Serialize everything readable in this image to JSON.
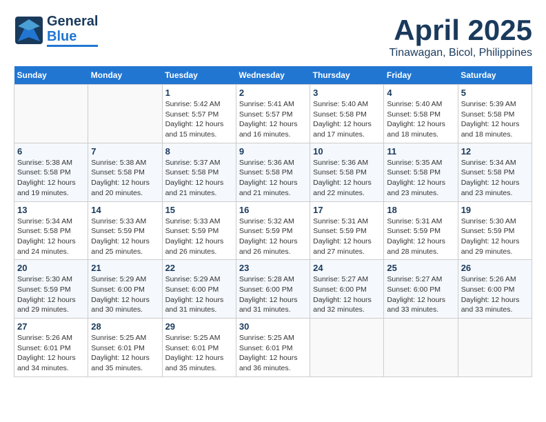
{
  "header": {
    "logo_general": "General",
    "logo_blue": "Blue",
    "month_title": "April 2025",
    "location": "Tinawagan, Bicol, Philippines"
  },
  "weekdays": [
    "Sunday",
    "Monday",
    "Tuesday",
    "Wednesday",
    "Thursday",
    "Friday",
    "Saturday"
  ],
  "weeks": [
    [
      {
        "day": "",
        "sunrise": "",
        "sunset": "",
        "daylight": ""
      },
      {
        "day": "",
        "sunrise": "",
        "sunset": "",
        "daylight": ""
      },
      {
        "day": "1",
        "sunrise": "Sunrise: 5:42 AM",
        "sunset": "Sunset: 5:57 PM",
        "daylight": "Daylight: 12 hours and 15 minutes."
      },
      {
        "day": "2",
        "sunrise": "Sunrise: 5:41 AM",
        "sunset": "Sunset: 5:57 PM",
        "daylight": "Daylight: 12 hours and 16 minutes."
      },
      {
        "day": "3",
        "sunrise": "Sunrise: 5:40 AM",
        "sunset": "Sunset: 5:58 PM",
        "daylight": "Daylight: 12 hours and 17 minutes."
      },
      {
        "day": "4",
        "sunrise": "Sunrise: 5:40 AM",
        "sunset": "Sunset: 5:58 PM",
        "daylight": "Daylight: 12 hours and 18 minutes."
      },
      {
        "day": "5",
        "sunrise": "Sunrise: 5:39 AM",
        "sunset": "Sunset: 5:58 PM",
        "daylight": "Daylight: 12 hours and 18 minutes."
      }
    ],
    [
      {
        "day": "6",
        "sunrise": "Sunrise: 5:38 AM",
        "sunset": "Sunset: 5:58 PM",
        "daylight": "Daylight: 12 hours and 19 minutes."
      },
      {
        "day": "7",
        "sunrise": "Sunrise: 5:38 AM",
        "sunset": "Sunset: 5:58 PM",
        "daylight": "Daylight: 12 hours and 20 minutes."
      },
      {
        "day": "8",
        "sunrise": "Sunrise: 5:37 AM",
        "sunset": "Sunset: 5:58 PM",
        "daylight": "Daylight: 12 hours and 21 minutes."
      },
      {
        "day": "9",
        "sunrise": "Sunrise: 5:36 AM",
        "sunset": "Sunset: 5:58 PM",
        "daylight": "Daylight: 12 hours and 21 minutes."
      },
      {
        "day": "10",
        "sunrise": "Sunrise: 5:36 AM",
        "sunset": "Sunset: 5:58 PM",
        "daylight": "Daylight: 12 hours and 22 minutes."
      },
      {
        "day": "11",
        "sunrise": "Sunrise: 5:35 AM",
        "sunset": "Sunset: 5:58 PM",
        "daylight": "Daylight: 12 hours and 23 minutes."
      },
      {
        "day": "12",
        "sunrise": "Sunrise: 5:34 AM",
        "sunset": "Sunset: 5:58 PM",
        "daylight": "Daylight: 12 hours and 23 minutes."
      }
    ],
    [
      {
        "day": "13",
        "sunrise": "Sunrise: 5:34 AM",
        "sunset": "Sunset: 5:58 PM",
        "daylight": "Daylight: 12 hours and 24 minutes."
      },
      {
        "day": "14",
        "sunrise": "Sunrise: 5:33 AM",
        "sunset": "Sunset: 5:59 PM",
        "daylight": "Daylight: 12 hours and 25 minutes."
      },
      {
        "day": "15",
        "sunrise": "Sunrise: 5:33 AM",
        "sunset": "Sunset: 5:59 PM",
        "daylight": "Daylight: 12 hours and 26 minutes."
      },
      {
        "day": "16",
        "sunrise": "Sunrise: 5:32 AM",
        "sunset": "Sunset: 5:59 PM",
        "daylight": "Daylight: 12 hours and 26 minutes."
      },
      {
        "day": "17",
        "sunrise": "Sunrise: 5:31 AM",
        "sunset": "Sunset: 5:59 PM",
        "daylight": "Daylight: 12 hours and 27 minutes."
      },
      {
        "day": "18",
        "sunrise": "Sunrise: 5:31 AM",
        "sunset": "Sunset: 5:59 PM",
        "daylight": "Daylight: 12 hours and 28 minutes."
      },
      {
        "day": "19",
        "sunrise": "Sunrise: 5:30 AM",
        "sunset": "Sunset: 5:59 PM",
        "daylight": "Daylight: 12 hours and 29 minutes."
      }
    ],
    [
      {
        "day": "20",
        "sunrise": "Sunrise: 5:30 AM",
        "sunset": "Sunset: 5:59 PM",
        "daylight": "Daylight: 12 hours and 29 minutes."
      },
      {
        "day": "21",
        "sunrise": "Sunrise: 5:29 AM",
        "sunset": "Sunset: 6:00 PM",
        "daylight": "Daylight: 12 hours and 30 minutes."
      },
      {
        "day": "22",
        "sunrise": "Sunrise: 5:29 AM",
        "sunset": "Sunset: 6:00 PM",
        "daylight": "Daylight: 12 hours and 31 minutes."
      },
      {
        "day": "23",
        "sunrise": "Sunrise: 5:28 AM",
        "sunset": "Sunset: 6:00 PM",
        "daylight": "Daylight: 12 hours and 31 minutes."
      },
      {
        "day": "24",
        "sunrise": "Sunrise: 5:27 AM",
        "sunset": "Sunset: 6:00 PM",
        "daylight": "Daylight: 12 hours and 32 minutes."
      },
      {
        "day": "25",
        "sunrise": "Sunrise: 5:27 AM",
        "sunset": "Sunset: 6:00 PM",
        "daylight": "Daylight: 12 hours and 33 minutes."
      },
      {
        "day": "26",
        "sunrise": "Sunrise: 5:26 AM",
        "sunset": "Sunset: 6:00 PM",
        "daylight": "Daylight: 12 hours and 33 minutes."
      }
    ],
    [
      {
        "day": "27",
        "sunrise": "Sunrise: 5:26 AM",
        "sunset": "Sunset: 6:01 PM",
        "daylight": "Daylight: 12 hours and 34 minutes."
      },
      {
        "day": "28",
        "sunrise": "Sunrise: 5:25 AM",
        "sunset": "Sunset: 6:01 PM",
        "daylight": "Daylight: 12 hours and 35 minutes."
      },
      {
        "day": "29",
        "sunrise": "Sunrise: 5:25 AM",
        "sunset": "Sunset: 6:01 PM",
        "daylight": "Daylight: 12 hours and 35 minutes."
      },
      {
        "day": "30",
        "sunrise": "Sunrise: 5:25 AM",
        "sunset": "Sunset: 6:01 PM",
        "daylight": "Daylight: 12 hours and 36 minutes."
      },
      {
        "day": "",
        "sunrise": "",
        "sunset": "",
        "daylight": ""
      },
      {
        "day": "",
        "sunrise": "",
        "sunset": "",
        "daylight": ""
      },
      {
        "day": "",
        "sunrise": "",
        "sunset": "",
        "daylight": ""
      }
    ]
  ]
}
